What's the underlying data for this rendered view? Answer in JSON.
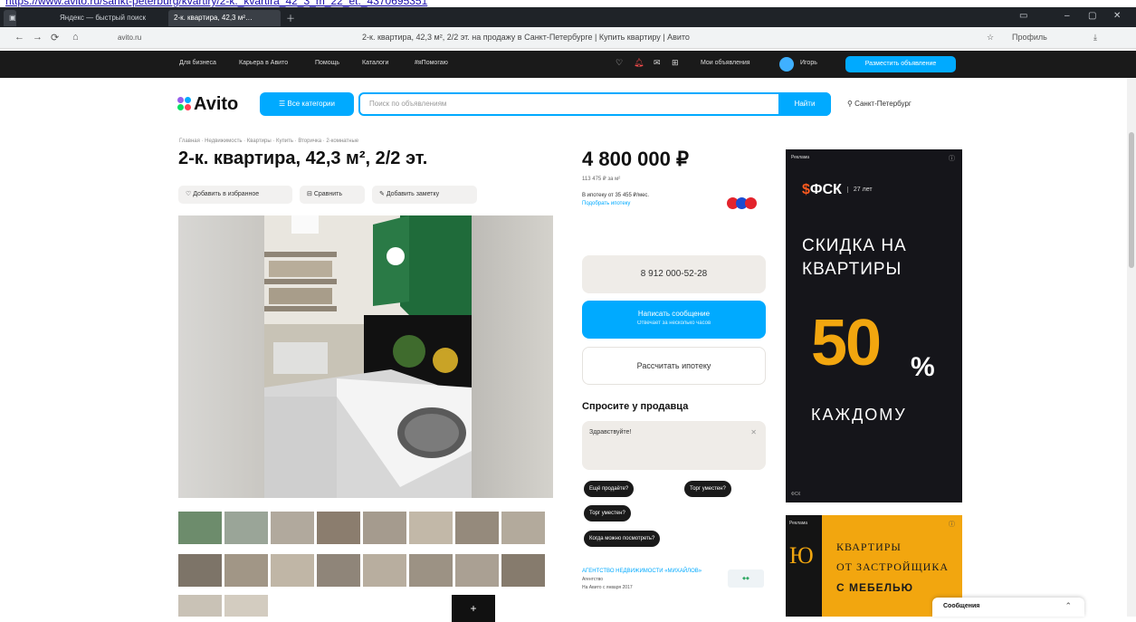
{
  "url": "https://www.avito.ru/sankt-peterburg/kvartiry/2-k._kvartira_42_3_m_22_et._4370695351",
  "browser": {
    "tabs": [
      {
        "label": "Яндекс — быстрый поиск"
      },
      {
        "label": "2-к. квартира, 42,3 м²…"
      }
    ],
    "page_title": "2-к. квартира, 42,3 м², 2/2 эт. на продажу в Санкт-Петербурге | Купить квартиру | Авито",
    "address_text": "avito.ru",
    "profile_label": "Профиль"
  },
  "topnav": {
    "items": [
      "Для бизнеса",
      "Карьера в Авито",
      "Помощь",
      "Каталоги",
      "#яПомогаю"
    ],
    "my_ads": "Мои объявления",
    "user": "Игорь",
    "post_button": "Разместить объявление"
  },
  "header": {
    "logo": "Avito",
    "categories_button": "Все категории",
    "search_placeholder": "Поиск по объявлениям",
    "search_button": "Найти",
    "location": "Санкт-Петербург"
  },
  "breadcrumbs": "Главная · Недвижимость · Квартиры · Купить · Вторичка · 2-комнатные",
  "listing": {
    "title": "2-к. квартира, 42,3 м², 2/2 эт.",
    "actions": {
      "favorite": "Добавить в избранное",
      "compare": "Сравнить",
      "note": "Добавить заметку"
    },
    "price": "4 800 000 ₽",
    "price_per_m": "113 475 ₽ за м²",
    "mortgage_line1": "В ипотеку от 35 455 ₽/мес.",
    "mortgage_link": "Подобрать ипотеку",
    "phone": "8 912 000-52-28",
    "message_button": "Написать сообщение",
    "message_sub": "Отвечает за несколько часов",
    "calc_button": "Рассчитать ипотеку",
    "ask_title": "Спросите у продавца",
    "ask_placeholder": "Здравствуйте!",
    "chips": [
      "Ещё продаёте?",
      "Торг уместен?",
      "Торг уместен?",
      "Когда можно посмотреть?"
    ],
    "seller": {
      "name": "АГЕНТСТВО НЕДВИЖИМОСТИ «МИХАЙЛОВ»",
      "type": "Агентство",
      "since": "На Авито с января 2017"
    },
    "thumb_more": "+"
  },
  "ad1": {
    "tag": "Реклама",
    "brand": "ФСК",
    "years": "27 лет",
    "line1": "СКИДКА НА",
    "line2": "КВАРТИРЫ",
    "big": "50",
    "pct": "%",
    "line3": "КАЖДОМУ",
    "foot": "ФСК"
  },
  "ad2": {
    "tag": "Реклама",
    "glyph": "Ю",
    "line1": "КВАРТИРЫ",
    "line2": "ОТ ЗАСТРОЙЩИКА",
    "line3": "С МЕБЕЛЬЮ"
  },
  "messenger": {
    "label": "Сообщения"
  },
  "colors": {
    "accent": "#00aaff",
    "topbar": "#1a1a1a",
    "ad_orange": "#f2a60f"
  }
}
